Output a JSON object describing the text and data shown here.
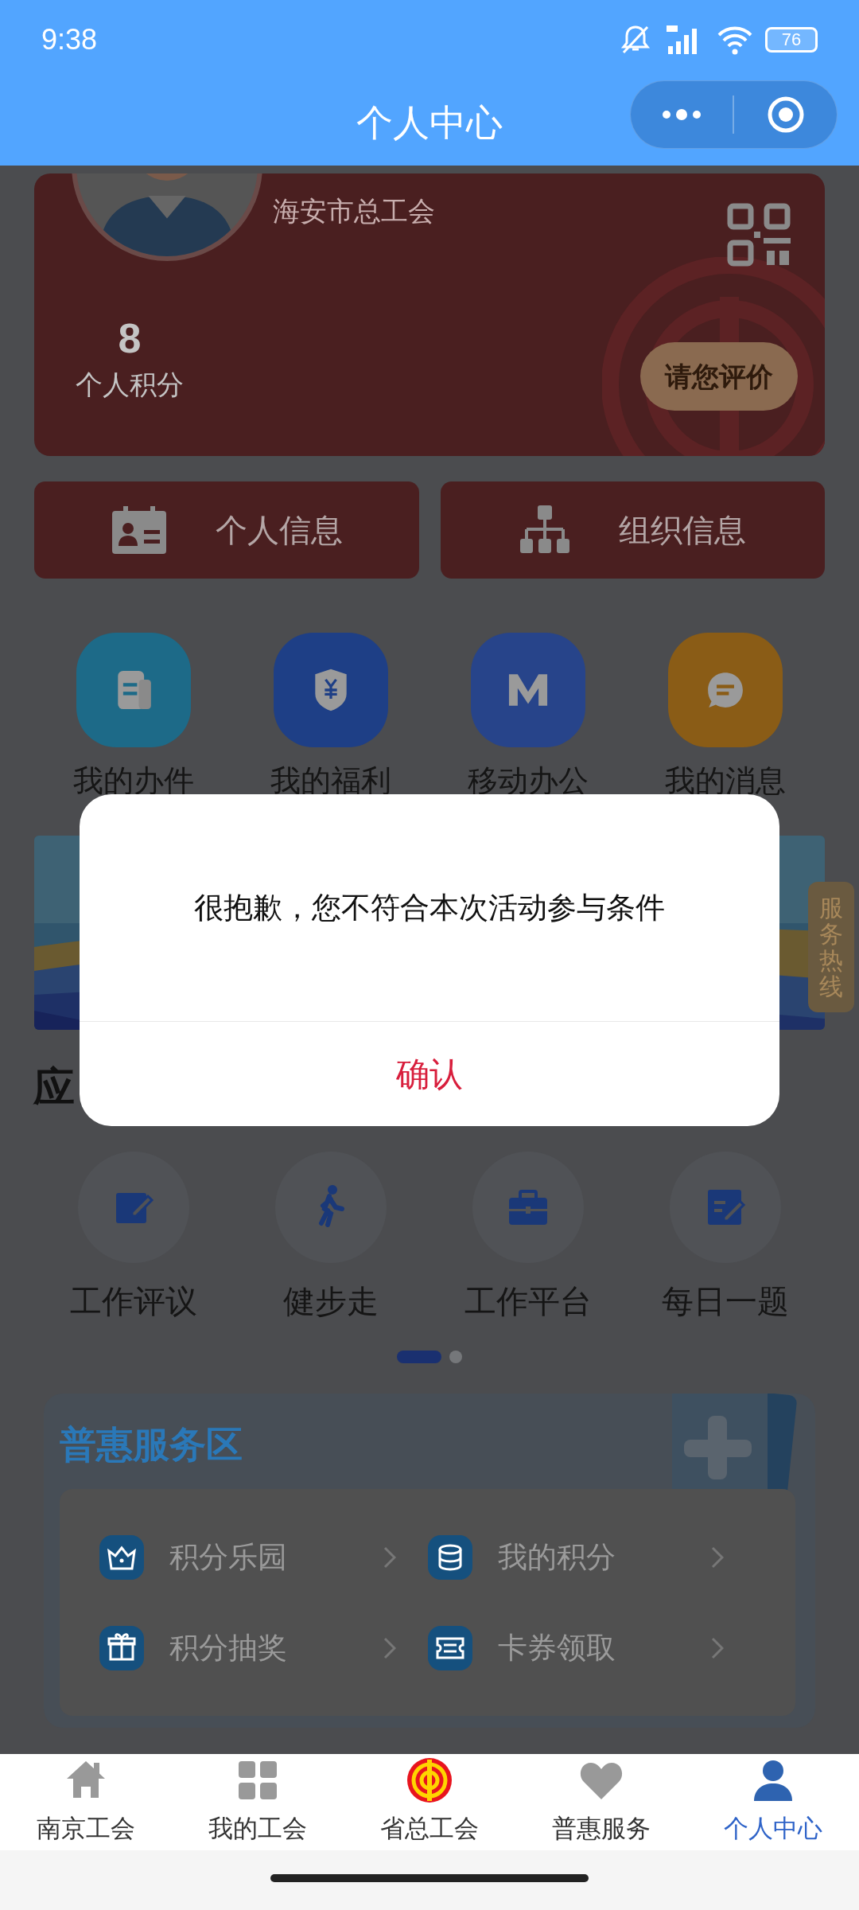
{
  "status_bar": {
    "time": "9:38",
    "battery": "76"
  },
  "header": {
    "title": "个人中心"
  },
  "profile_card": {
    "organization": "海安市总工会",
    "points": "8",
    "points_label": "个人积分",
    "rate_button": "请您评价"
  },
  "info_buttons": [
    "个人信息",
    "组织信息"
  ],
  "shortcuts": [
    {
      "label": "我的办件",
      "color": "#1d6a88"
    },
    {
      "label": "我的福利",
      "color": "#1e3f86"
    },
    {
      "label": "移动办公",
      "color": "#27448a"
    },
    {
      "label": "我的消息",
      "color": "#8a5c16"
    }
  ],
  "side_tab": "服务热线",
  "section_title": "应",
  "apps": [
    "工作评议",
    "健步走",
    "工作平台",
    "每日一题"
  ],
  "pager": [
    {
      "selected": true
    },
    {
      "selected": false
    }
  ],
  "benefits": {
    "title": "普惠服务区",
    "items": [
      "积分乐园",
      "我的积分",
      "积分抽奖",
      "卡券领取"
    ]
  },
  "dialog": {
    "message": "很抱歉，您不符合本次活动参与条件",
    "confirm": "确认"
  },
  "tab_bar": [
    {
      "label": "南京工会",
      "selected": false
    },
    {
      "label": "我的工会",
      "selected": false
    },
    {
      "label": "省总工会",
      "selected": false
    },
    {
      "label": "普惠服务",
      "selected": false
    },
    {
      "label": "个人中心",
      "selected": true
    }
  ]
}
